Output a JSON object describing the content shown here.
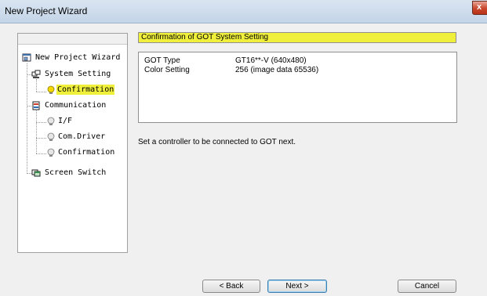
{
  "window": {
    "title": "New Project Wizard",
    "close_glyph": "x"
  },
  "tree": {
    "items": [
      {
        "label": "New Project Wizard",
        "icon": "project-icon"
      },
      {
        "label": "System Setting",
        "icon": "system-icon"
      },
      {
        "label": "Confirmation",
        "icon": "lightbulb-icon",
        "selected": true
      },
      {
        "label": "Communication",
        "icon": "communication-icon"
      },
      {
        "label": "I/F",
        "icon": "lightbulb-icon"
      },
      {
        "label": "Com.Driver",
        "icon": "lightbulb-icon"
      },
      {
        "label": "Confirmation",
        "icon": "lightbulb-icon"
      },
      {
        "label": "Screen Switch",
        "icon": "screen-switch-icon"
      }
    ]
  },
  "summary": {
    "title": "Confirmation of GOT System Setting",
    "rows": [
      {
        "label": "GOT Type",
        "value": "GT16**-V (640x480)"
      },
      {
        "label": "Color Setting",
        "value": "256 (image data 65536)"
      }
    ]
  },
  "info_text": "Set a controller to be connected to GOT next.",
  "buttons": {
    "back": "< Back",
    "next": "Next >",
    "cancel": "Cancel"
  },
  "colors": {
    "highlight": "#f0f03c",
    "titlebar": "#c3d4e7",
    "close": "#c9462c"
  }
}
